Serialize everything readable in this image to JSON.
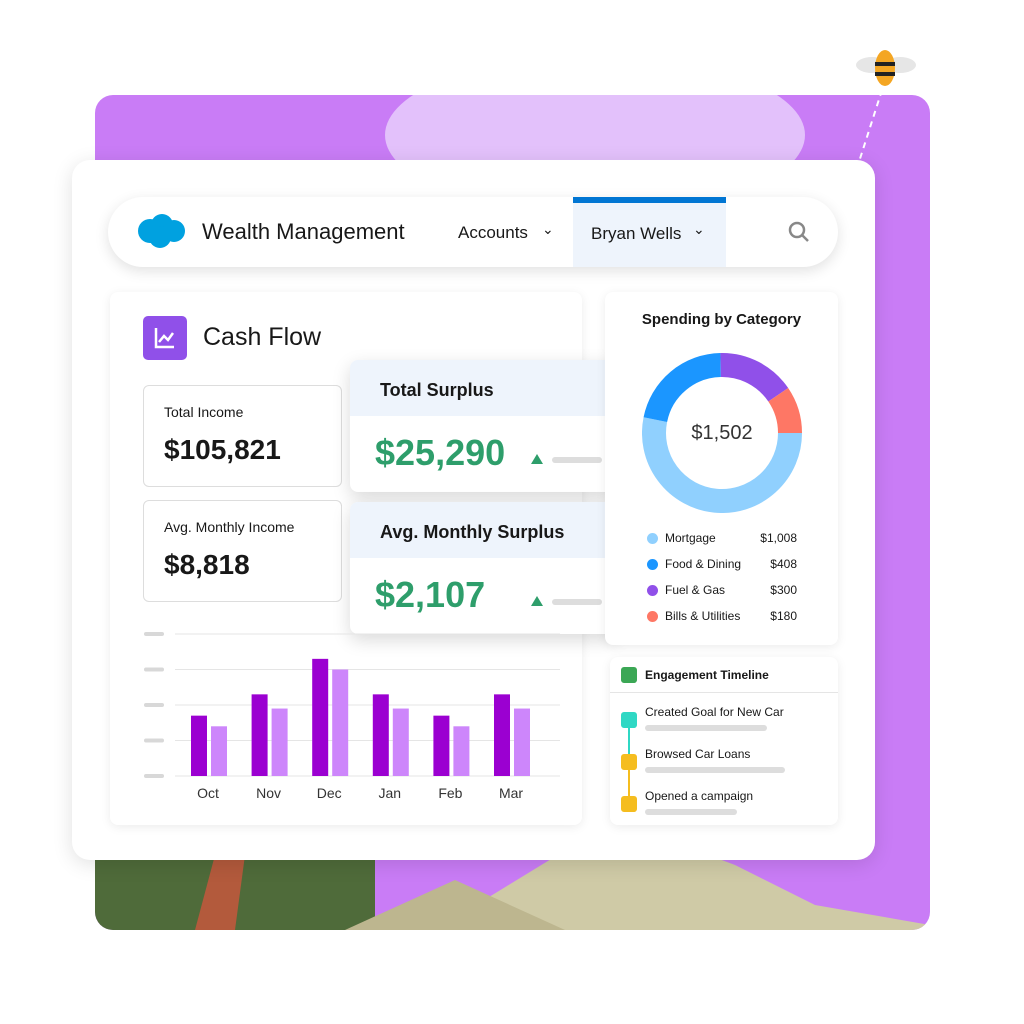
{
  "nav": {
    "app_title": "Wealth Management",
    "tabs": [
      {
        "label": "Accounts",
        "active": false
      },
      {
        "label": "Bryan Wells",
        "active": true
      }
    ],
    "accent": "#0176d3"
  },
  "cash_flow": {
    "title": "Cash Flow",
    "total_income": {
      "label": "Total Income",
      "value": "$105,821"
    },
    "avg_monthly_income": {
      "label": "Avg. Monthly Income",
      "value": "$8,818"
    },
    "total_surplus": {
      "label": "Total Surplus",
      "value": "$25,290",
      "trend": "up"
    },
    "avg_monthly_surplus": {
      "label": "Avg. Monthly Surplus",
      "value": "$2,107",
      "trend": "up"
    }
  },
  "spending": {
    "title": "Spending by Category",
    "total": "$1,502",
    "categories": [
      {
        "name": "Mortgage",
        "value": "$1,008",
        "color": "#90d0fe"
      },
      {
        "name": "Food & Dining",
        "value": "$408",
        "color": "#1b96ff"
      },
      {
        "name": "Fuel & Gas",
        "value": "$300",
        "color": "#9050e9"
      },
      {
        "name": "Bills & Utilities",
        "value": "$180",
        "color": "#fe7765"
      }
    ]
  },
  "timeline": {
    "title": "Engagement Timeline",
    "items": [
      {
        "label": "Created Goal for New Car",
        "color": "#2fd8c4"
      },
      {
        "label": "Browsed Car Loans",
        "color": "#f5bd1f"
      },
      {
        "label": "Opened a campaign",
        "color": "#f5bd1f"
      }
    ]
  },
  "chart_data": {
    "type": "bar",
    "categories": [
      "Oct",
      "Nov",
      "Dec",
      "Jan",
      "Feb",
      "Mar"
    ],
    "series": [
      {
        "values": [
          1.7,
          2.3,
          3.3,
          2.3,
          1.7,
          2.3
        ],
        "color": "#9b00d1"
      },
      {
        "values": [
          1.4,
          1.9,
          3.0,
          1.9,
          1.4,
          1.9
        ],
        "color": "#cd86fb"
      }
    ],
    "ylim": [
      0,
      4
    ],
    "grid": true
  }
}
